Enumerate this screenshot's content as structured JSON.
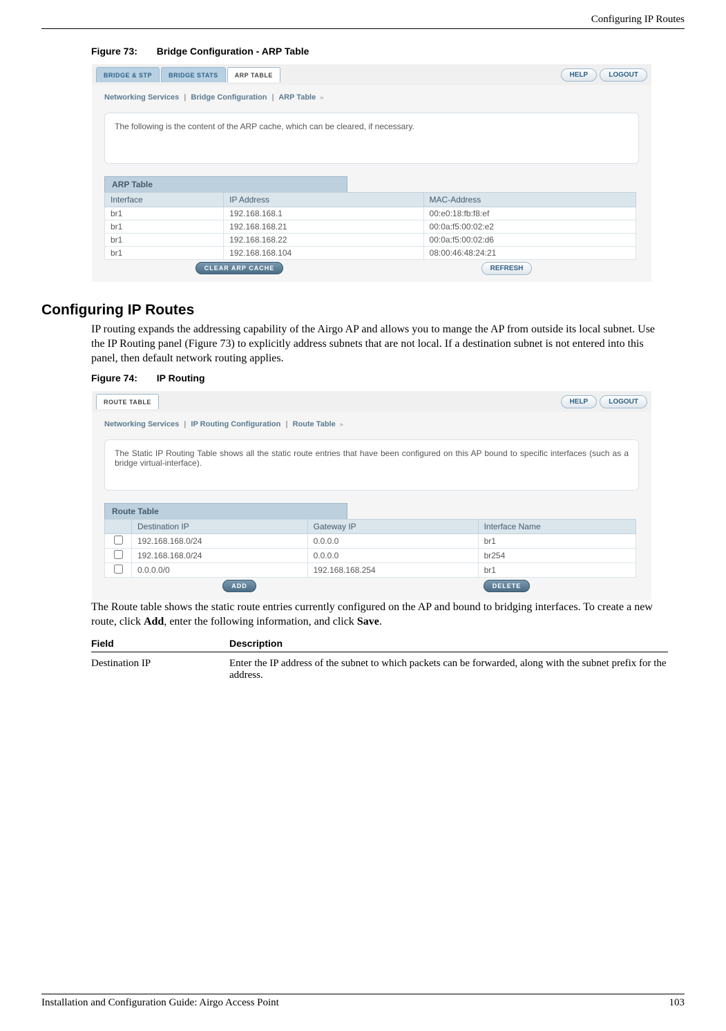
{
  "header": {
    "right": "Configuring IP Routes"
  },
  "fig73": {
    "num": "Figure 73:",
    "title": "Bridge Configuration - ARP Table"
  },
  "arp_ss": {
    "tabs": [
      "BRIDGE & STP",
      "BRIDGE STATS",
      "ARP TABLE"
    ],
    "active_tab": 2,
    "help": "HELP",
    "logout": "LOGOUT",
    "crumb": [
      "Networking Services",
      "Bridge Configuration",
      "ARP Table"
    ],
    "desc": "The following is the content of the ARP cache, which can be cleared, if necessary.",
    "table_title": "ARP Table",
    "cols": [
      "Interface",
      "IP Address",
      "MAC-Address"
    ],
    "rows": [
      [
        "br1",
        "192.168.168.1",
        "00:e0:18:fb:f8:ef"
      ],
      [
        "br1",
        "192.168.168.21",
        "00:0a:f5:00:02:e2"
      ],
      [
        "br1",
        "192.168.168.22",
        "00:0a:f5:00:02:d6"
      ],
      [
        "br1",
        "192.168.168.104",
        "08:00:46:48:24:21"
      ]
    ],
    "btn_left": "CLEAR ARP CACHE",
    "btn_right": "REFRESH"
  },
  "section": {
    "heading": "Configuring IP Routes",
    "para1": "IP routing expands the addressing capability of the Airgo AP and allows you to mange the AP from outside its local subnet. Use the IP Routing panel (Figure 73) to explicitly address subnets that are not local. If a destination subnet is not entered into this panel, then default network routing applies."
  },
  "fig74": {
    "num": "Figure 74:",
    "title": "IP Routing"
  },
  "route_ss": {
    "tabs": [
      "ROUTE TABLE"
    ],
    "active_tab": 0,
    "help": "HELP",
    "logout": "LOGOUT",
    "crumb": [
      "Networking Services",
      "IP Routing Configuration",
      "Route Table"
    ],
    "desc": "The Static IP Routing Table shows all the static route entries that have been configured on this AP bound to specific interfaces (such as a bridge virtual-interface).",
    "table_title": "Route Table",
    "cols": [
      "Destination IP",
      "Gateway IP",
      "Interface Name"
    ],
    "rows": [
      [
        "192.168.168.0/24",
        "0.0.0.0",
        "br1"
      ],
      [
        "192.168.168.0/24",
        "0.0.0.0",
        "br254"
      ],
      [
        "0.0.0.0/0",
        "192.168.168.254",
        "br1"
      ]
    ],
    "btn_left": "ADD",
    "btn_right": "DELETE"
  },
  "para2_pre": "The Route table shows the static route entries currently configured on the AP and bound to bridging interfaces. To create a new route, click ",
  "para2_b1": "Add",
  "para2_mid": ", enter the following information, and click ",
  "para2_b2": "Save",
  "para2_post": ".",
  "ftable": {
    "h1": "Field",
    "h2": "Description",
    "r1c1": "Destination IP",
    "r1c2": "Enter the IP address of the subnet to which packets can be forwarded, along with the subnet prefix for the address."
  },
  "footer": {
    "left": "Installation and Configuration Guide: Airgo Access Point",
    "right": "103"
  }
}
